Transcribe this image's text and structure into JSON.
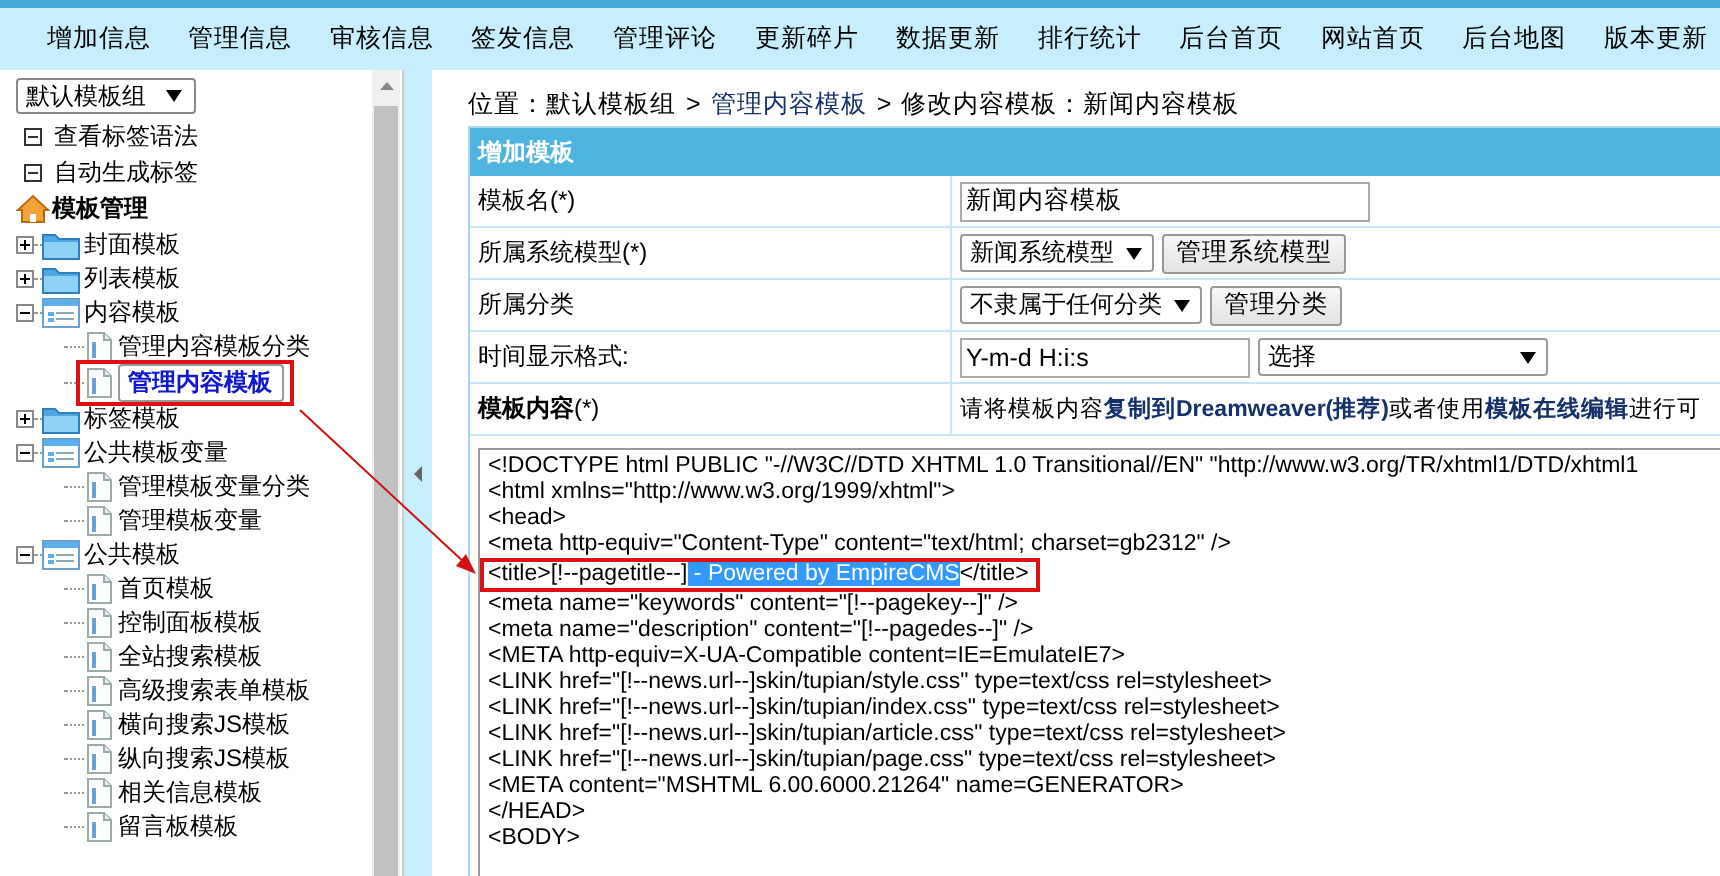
{
  "nav": [
    "增加信息",
    "管理信息",
    "审核信息",
    "签发信息",
    "管理评论",
    "更新碎片",
    "数据更新",
    "排行统计",
    "后台首页",
    "网站首页",
    "后台地图",
    "版本更新"
  ],
  "sidebar": {
    "group_select": "默认模板组",
    "links": [
      "查看标签语法",
      "自动生成标签"
    ],
    "root": "模板管理",
    "tree": [
      {
        "label": "封面模板",
        "expanded": false
      },
      {
        "label": "列表模板",
        "expanded": false
      },
      {
        "label": "内容模板",
        "expanded": true,
        "children": [
          {
            "label": "管理内容模板分类",
            "selected": false
          },
          {
            "label": "管理内容模板",
            "selected": true
          }
        ]
      },
      {
        "label": "标签模板",
        "expanded": false
      },
      {
        "label": "公共模板变量",
        "expanded": true,
        "children": [
          {
            "label": "管理模板变量分类",
            "selected": false
          },
          {
            "label": "管理模板变量",
            "selected": false
          }
        ]
      },
      {
        "label": "公共模板",
        "expanded": true,
        "children": [
          {
            "label": "首页模板",
            "selected": false
          },
          {
            "label": "控制面板模板",
            "selected": false
          },
          {
            "label": "全站搜索模板",
            "selected": false
          },
          {
            "label": "高级搜索表单模板",
            "selected": false
          },
          {
            "label": "横向搜索JS模板",
            "selected": false
          },
          {
            "label": "纵向搜索JS模板",
            "selected": false
          },
          {
            "label": "相关信息模板",
            "selected": false
          },
          {
            "label": "留言板模板",
            "selected": false
          }
        ]
      }
    ]
  },
  "breadcrumb": [
    {
      "text": "位置：默认模板组",
      "link": false
    },
    {
      "text": ">",
      "link": false
    },
    {
      "text": "管理内容模板",
      "link": true
    },
    {
      "text": ">",
      "link": false
    },
    {
      "text": "修改内容模板：新闻内容模板",
      "link": false
    }
  ],
  "form": {
    "title": "增加模板",
    "rows": [
      {
        "kind": "input",
        "label": "模板名(*)",
        "value": "新闻内容模板"
      },
      {
        "kind": "select_button",
        "label": "所属系统模型(*)",
        "select": "新闻系统模型",
        "button": "管理系统模型"
      },
      {
        "kind": "select_button",
        "label": "所属分类",
        "select": "不隶属于任何分类",
        "button": "管理分类"
      },
      {
        "kind": "input_select",
        "label": "时间显示格式:",
        "value": "Y-m-d H:i:s",
        "select": "选择"
      },
      {
        "kind": "note",
        "label": "模板内容",
        "label_suffix": "(*)",
        "parts": [
          {
            "text": "请将模板内容",
            "link": false
          },
          {
            "text": "复制到Dreamweaver(推荐)",
            "link": true
          },
          {
            "text": "或者使用",
            "link": false
          },
          {
            "text": "模板在线编辑",
            "link": true
          },
          {
            "text": "进行可",
            "link": false
          }
        ]
      }
    ]
  },
  "code": {
    "lines": [
      "<!DOCTYPE html PUBLIC \"-//W3C//DTD XHTML 1.0 Transitional//EN\" \"http://www.w3.org/TR/xhtml1/DTD/xhtml1",
      "<html xmlns=\"http://www.w3.org/1999/xhtml\">",
      "<head>",
      "<meta http-equiv=\"Content-Type\" content=\"text/html; charset=gb2312\" />",
      {
        "before": "<title>[!--pagetitle--]",
        "selected_text": " - Powered by EmpireCMS",
        "after": "</title>"
      },
      "<meta name=\"keywords\" content=\"[!--pagekey--]\" />",
      "<meta name=\"description\" content=\"[!--pagedes--]\" />",
      "<META http-equiv=X-UA-Compatible content=IE=EmulateIE7>",
      "<LINK href=\"[!--news.url--]skin/tupian/style.css\" type=text/css rel=stylesheet>",
      "<LINK href=\"[!--news.url--]skin/tupian/index.css\" type=text/css rel=stylesheet>",
      "<LINK href=\"[!--news.url--]skin/tupian/article.css\" type=text/css rel=stylesheet>",
      "<LINK href=\"[!--news.url--]skin/tupian/page.css\" type=text/css rel=stylesheet>",
      "<META content=\"MSHTML 6.00.6000.21264\" name=GENERATOR>",
      "</HEAD>",
      "<BODY>"
    ]
  }
}
